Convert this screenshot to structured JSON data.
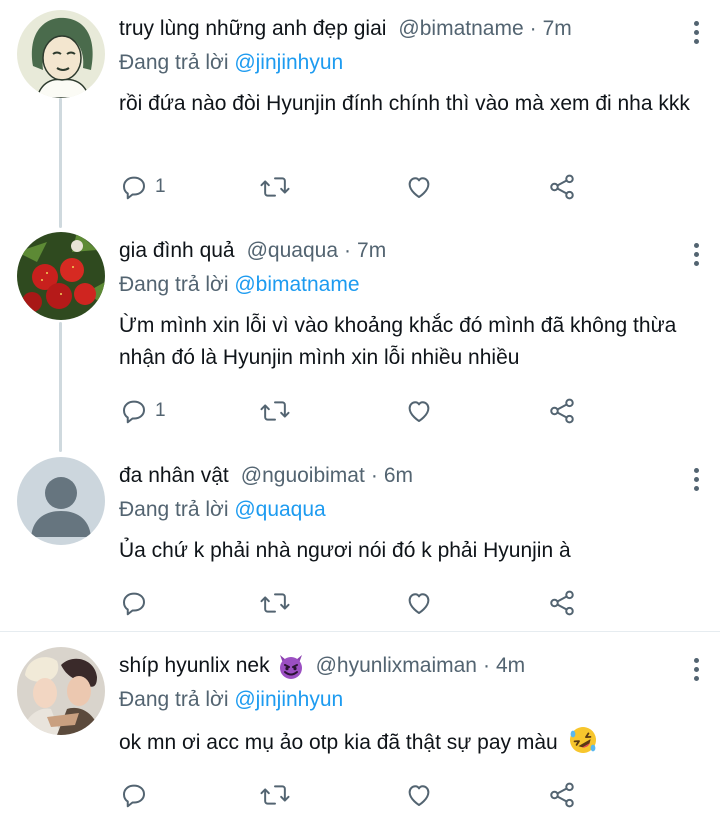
{
  "tweets": [
    {
      "name": "truy lùng những anh đẹp giai",
      "handle": "@bimatname",
      "time": "7m",
      "replying_label": "Đang trả lời",
      "replying_to": "@jinjinhyun",
      "text": "rồi đứa nào đòi Hyunjin đính chính thì vào mà xem đi nha kkk",
      "reply_count": "1",
      "avatar": "drawn-girl-avatar"
    },
    {
      "name": "gia đình quả",
      "handle": "@quaqua",
      "time": "7m",
      "replying_label": "Đang trả lời",
      "replying_to": "@bimatname",
      "text": "Ừm mình xin lỗi vì vào khoảng khắc đó mình đã không thừa nhận đó là Hyunjin mình xin lỗi nhiều nhiều",
      "reply_count": "1",
      "avatar": "strawberries-avatar"
    },
    {
      "name": "đa nhân vật",
      "handle": "@nguoibimat",
      "time": "6m",
      "replying_label": "Đang trả lời",
      "replying_to": "@quaqua",
      "text": "Ủa chứ k phải nhà ngươi nói đó k phải Hyunjin à",
      "reply_count": "",
      "avatar": "default-avatar"
    },
    {
      "name": "shíp hyunlix nek",
      "name_emoji": "smiling-imp-emoji",
      "handle": "@hyunlixmaiman",
      "time": "4m",
      "replying_label": "Đang trả lời",
      "replying_to": "@jinjinhyun",
      "text": "ok mn ơi acc mụ ảo otp kia đã thật sự pay màu",
      "text_emoji": "rolling-on-floor-laughing-emoji",
      "reply_count": "",
      "avatar": "couple-photo-avatar"
    }
  ],
  "icons": {
    "reply": "reply-icon",
    "retweet": "retweet-icon",
    "like": "heart-icon",
    "share": "share-icon",
    "more": "more-options-icon"
  },
  "colors": {
    "text": "#0f1419",
    "secondary": "#536471",
    "link": "#1d9bf0",
    "thread_line": "#cfd9de",
    "divider": "#e6ecf0"
  }
}
